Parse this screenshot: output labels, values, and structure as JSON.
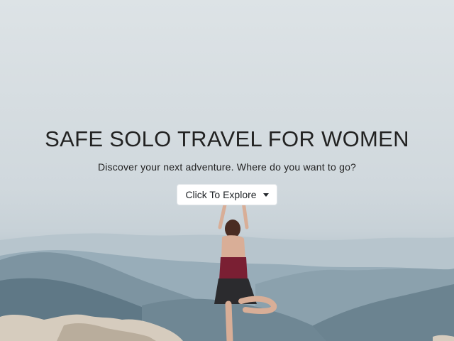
{
  "hero": {
    "title": "SAFE SOLO TRAVEL FOR WOMEN",
    "subtitle": "Discover your next adventure. Where do you want to go?",
    "explore_button_label": "Click To Explore",
    "explore_button_icon": "caret-down-icon"
  },
  "colors": {
    "sky": "#dde3e6",
    "mountain_far": "#9fb1bd",
    "mountain_near": "#5f7684",
    "rock": "#d6ccbe",
    "button_bg": "#ffffff",
    "text": "#212529"
  }
}
